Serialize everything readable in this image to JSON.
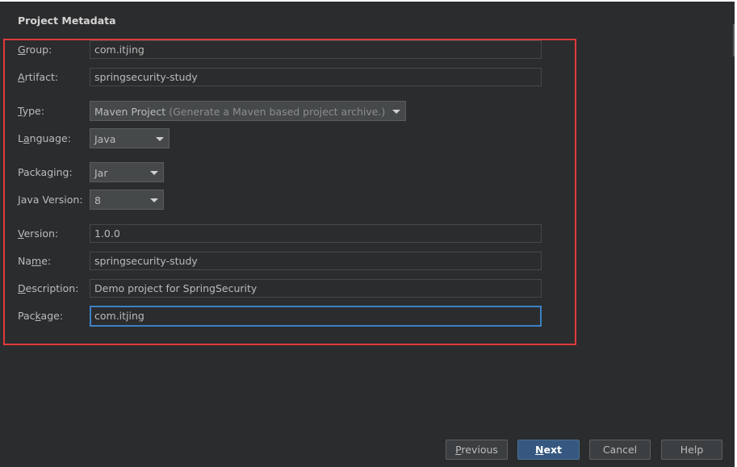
{
  "title": "Project Metadata",
  "fields": {
    "group": {
      "label_mnemonic": "G",
      "label_rest": "roup:",
      "value": "com.itjing"
    },
    "artifact": {
      "label_mnemonic": "A",
      "label_rest": "rtifact:",
      "value": "springsecurity-study"
    },
    "type": {
      "label_mnemonic": "T",
      "label_rest": "ype:",
      "value": "Maven Project",
      "hint": "(Generate a Maven based project archive.)"
    },
    "language": {
      "label_pre": "L",
      "label_mnemonic": "a",
      "label_rest": "nguage:",
      "value": "Java"
    },
    "packaging": {
      "label_pre": "Packa",
      "label_mnemonic": "g",
      "label_rest": "ing:",
      "value": "Jar"
    },
    "java_version": {
      "label_mnemonic": "J",
      "label_rest": "ava Version:",
      "value": "8"
    },
    "version": {
      "label_mnemonic": "V",
      "label_rest": "ersion:",
      "value": "1.0.0"
    },
    "name": {
      "label_pre": "Na",
      "label_mnemonic": "m",
      "label_rest": "e:",
      "value": "springsecurity-study"
    },
    "description": {
      "label_mnemonic": "D",
      "label_rest": "escription:",
      "value": "Demo project for SpringSecurity"
    },
    "package": {
      "label_pre": "Pac",
      "label_mnemonic": "k",
      "label_rest": "age:",
      "value": "com.itjing"
    }
  },
  "buttons": {
    "previous": {
      "mnemonic": "P",
      "rest": "revious"
    },
    "next": {
      "mnemonic": "N",
      "rest": "ext"
    },
    "cancel": {
      "label": "Cancel"
    },
    "help": {
      "label": "Help"
    }
  },
  "colors": {
    "background": "#2b2c2e",
    "highlight": "#e03a3a",
    "focus": "#3d80c4",
    "primary_button": "#365880"
  }
}
